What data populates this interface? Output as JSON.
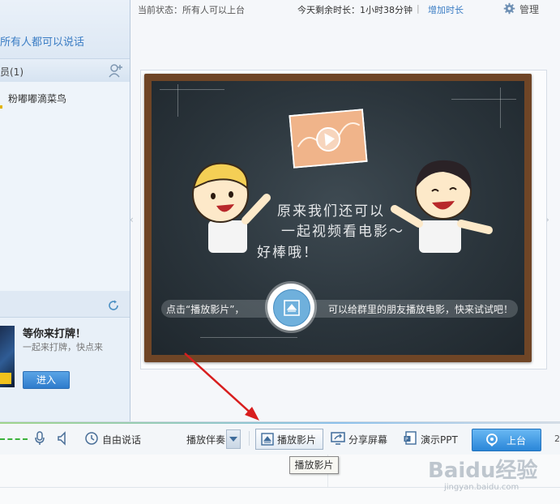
{
  "left_panel": {
    "notice": "所有人都可以说话",
    "members_title": "员(1)",
    "members": [
      {
        "name": "粉嘟嘟滴菜鸟"
      }
    ],
    "game": {
      "title": "等你来打牌！",
      "subtitle": "一起来打牌，快点来",
      "enter_label": "进入"
    }
  },
  "status": {
    "current": "当前状态：所有人可以上台",
    "remaining": "今天剩余时长：1小时38分钟",
    "separator": "|",
    "add_time": "增加时长",
    "manage": "管理"
  },
  "stage": {
    "board_text": [
      "原来我们还可以",
      "一起视频看电影～",
      "好棒哦！"
    ],
    "hint_left": "点击“播放影片”，",
    "hint_right": "可以给群里的朋友播放电影，快来试试吧！",
    "nav_prev": "‹",
    "nav_next": "›"
  },
  "toolbar": {
    "free_speak": "自由说话",
    "accompany": "播放伴奏",
    "play_movie": "播放影片",
    "share_screen": "分享屏幕",
    "ppt": "演示PPT",
    "go_stage": "上台",
    "edge": "2"
  },
  "tooltip": "播放影片",
  "watermark": {
    "text": "Baidu经验",
    "sub": "jingyan.baidu.com"
  },
  "colors": {
    "accent_blue": "#3b7dc4",
    "stage_button": "#2a86d8",
    "arrow_red": "#d81e1e",
    "board_wood": "#6f4526",
    "chalkboard": "#2b353c"
  },
  "icons": [
    "add-member-icon",
    "refresh-icon",
    "gear-icon",
    "play-circle-icon",
    "mic-icon",
    "speaker-icon",
    "free-speak-icon",
    "eject-icon",
    "share-screen-icon",
    "ppt-icon",
    "location-pin-icon"
  ]
}
